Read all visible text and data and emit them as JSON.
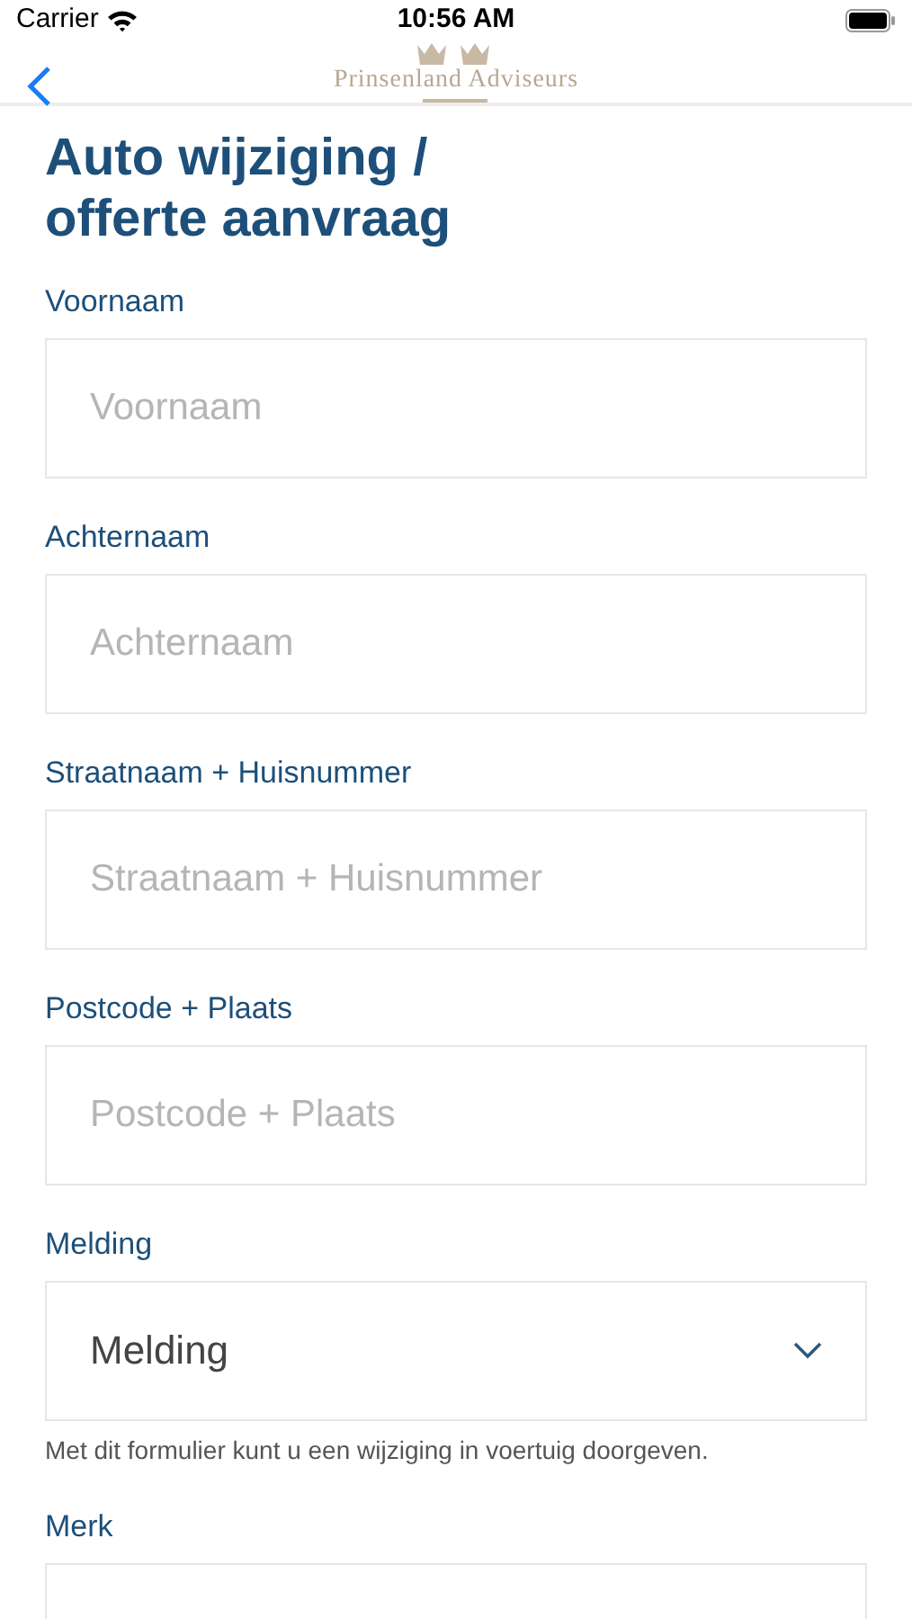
{
  "status_bar": {
    "carrier": "Carrier",
    "time": "10:56 AM"
  },
  "nav": {
    "logo_text": "Prinsenland Adviseurs"
  },
  "title": "Auto wijziging / offerte aanvraag",
  "fields": [
    {
      "kind": "text",
      "label": "Voornaam",
      "placeholder": "Voornaam"
    },
    {
      "kind": "text",
      "label": "Achternaam",
      "placeholder": "Achternaam"
    },
    {
      "kind": "text",
      "label": "Straatnaam + Huisnummer",
      "placeholder": "Straatnaam + Huisnummer"
    },
    {
      "kind": "text",
      "label": "Postcode + Plaats",
      "placeholder": "Postcode + Plaats"
    },
    {
      "kind": "select",
      "label": "Melding",
      "value": "Melding",
      "help": "Met dit formulier kunt u een wijziging in voertuig doorgeven."
    },
    {
      "kind": "text",
      "label": "Merk"
    }
  ]
}
